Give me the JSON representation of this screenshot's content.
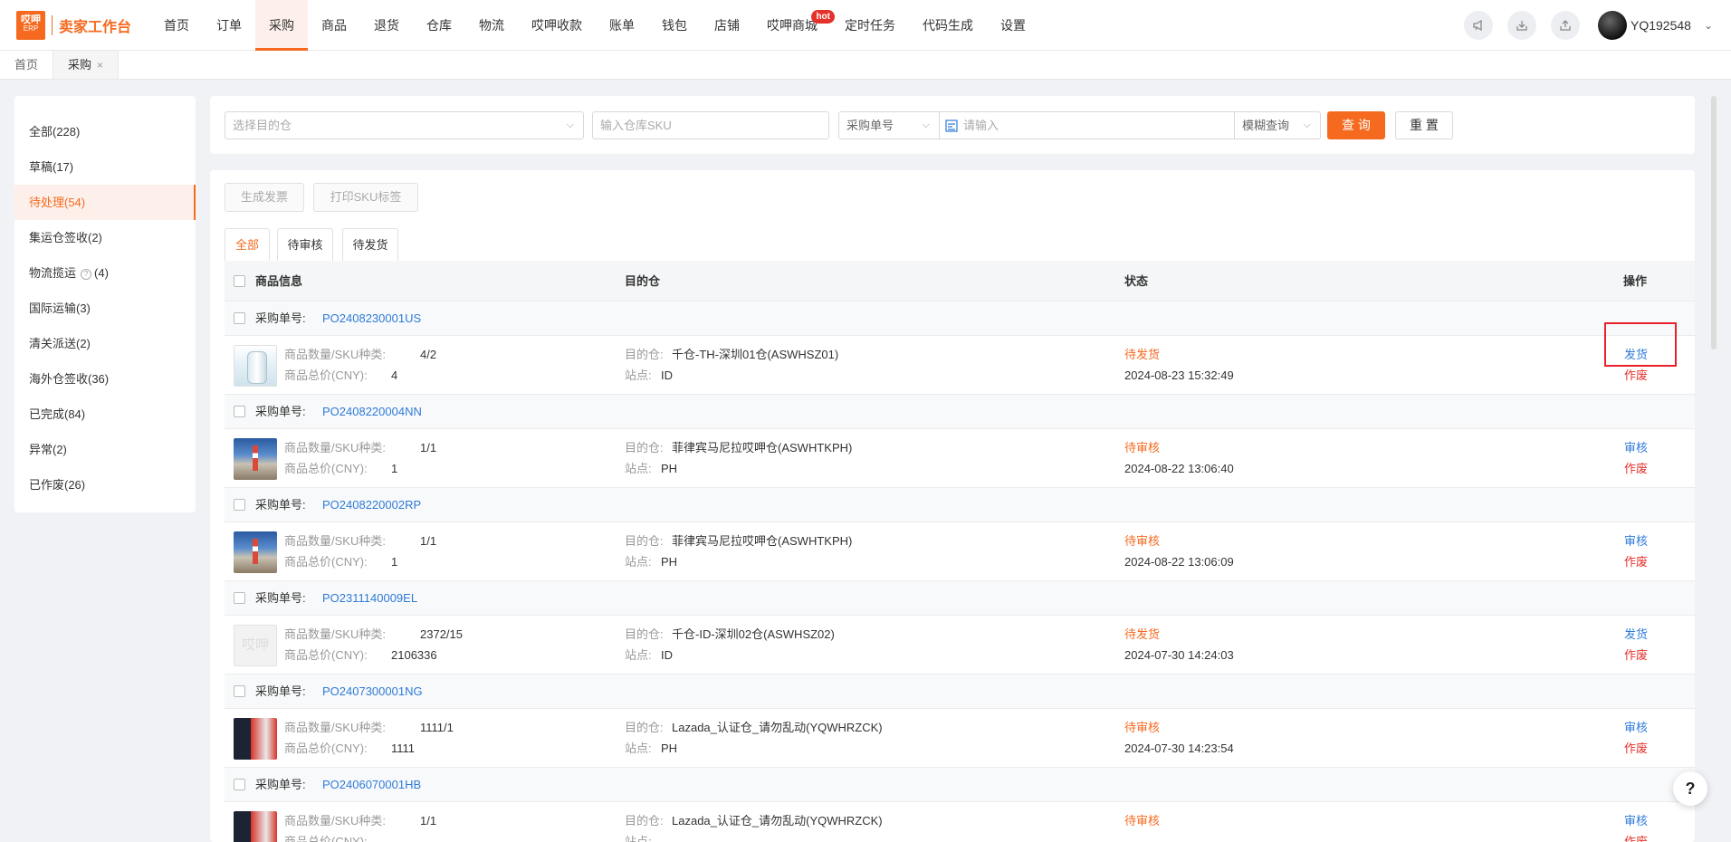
{
  "brand": {
    "logo_top": "哎呷",
    "logo_bottom": "ERP",
    "title": "卖家工作台"
  },
  "nav": {
    "items": [
      "首页",
      "订单",
      "采购",
      "商品",
      "退货",
      "仓库",
      "物流",
      "哎呷收款",
      "账单",
      "钱包",
      "店铺",
      "哎呷商城",
      "定时任务",
      "代码生成",
      "设置"
    ],
    "active": "采购",
    "hot_badge": "hot"
  },
  "user": {
    "name": "YQ192548",
    "chevron": "⌄"
  },
  "top_icons": [
    "megaphone-icon",
    "download-icon",
    "upload-icon"
  ],
  "tabs": {
    "home": "首页",
    "current": "采购",
    "close": "×"
  },
  "sidebar": {
    "items": [
      {
        "label": "全部(228)"
      },
      {
        "label": "草稿(17)"
      },
      {
        "label": "待处理(54)"
      },
      {
        "label": "集运仓签收(2)"
      },
      {
        "label": "物流揽运",
        "badge": "(4)",
        "help": "?"
      },
      {
        "label": "国际运输(3)"
      },
      {
        "label": "清关派送(2)"
      },
      {
        "label": "海外仓签收(36)"
      },
      {
        "label": "已完成(84)"
      },
      {
        "label": "异常(2)"
      },
      {
        "label": "已作废(26)"
      }
    ],
    "active_index": 2
  },
  "filters": {
    "warehouse_placeholder": "选择目的仓",
    "sku_placeholder": "输入仓库SKU",
    "search_type": "采购单号",
    "search_placeholder": "请输入",
    "match_mode": "模糊查询",
    "query_label": "查 询",
    "reset_label": "重 置"
  },
  "actions": {
    "invoice": "生成发票",
    "print_sku": "打印SKU标签"
  },
  "subtabs": [
    "全部",
    "待审核",
    "待发货"
  ],
  "table": {
    "columns": {
      "product": "商品信息",
      "warehouse": "目的仓",
      "status": "状态",
      "ops": "操作"
    },
    "po_label": "采购单号:",
    "qty_label": "商品数量/SKU种类:",
    "total_label": "商品总价(CNY):",
    "warehouse_label": "目的仓:",
    "site_label": "站点:",
    "void_label": "作废",
    "placeholder_text": "哎呷"
  },
  "orders": [
    {
      "po": "PO2408230001US",
      "qty": "4/2",
      "total": "4",
      "warehouse": "千仓-TH-深圳01仓(ASWHSZ01)",
      "site": "ID",
      "status": "待发货",
      "time": "2024-08-23 15:32:49",
      "action": "发货",
      "thumb": "box"
    },
    {
      "po": "PO2408220004NN",
      "qty": "1/1",
      "total": "1",
      "warehouse": "菲律宾马尼拉哎呷仓(ASWHTKPH)",
      "site": "PH",
      "status": "待审核",
      "time": "2024-08-22 13:06:40",
      "action": "审核",
      "thumb": "photo"
    },
    {
      "po": "PO2408220002RP",
      "qty": "1/1",
      "total": "1",
      "warehouse": "菲律宾马尼拉哎呷仓(ASWHTKPH)",
      "site": "PH",
      "status": "待审核",
      "time": "2024-08-22 13:06:09",
      "action": "审核",
      "thumb": "photo"
    },
    {
      "po": "PO2311140009EL",
      "qty": "2372/15",
      "total": "2106336",
      "warehouse": "千仓-ID-深圳02仓(ASWHSZ02)",
      "site": "ID",
      "status": "待发货",
      "time": "2024-07-30 14:24:03",
      "action": "发货",
      "thumb": "placeholder"
    },
    {
      "po": "PO2407300001NG",
      "qty": "1111/1",
      "total": "1111",
      "warehouse": "Lazada_认证仓_请勿乱动(YQWHRZCK)",
      "site": "PH",
      "status": "待审核",
      "time": "2024-07-30 14:23:54",
      "action": "审核",
      "thumb": "phone"
    },
    {
      "po": "PO2406070001HB",
      "qty": "1/1",
      "total": "",
      "warehouse": "Lazada_认证仓_请勿乱动(YQWHRZCK)",
      "site": "",
      "status": "待审核",
      "time": "",
      "action": "审核",
      "thumb": "phone"
    }
  ],
  "help_label": "?"
}
